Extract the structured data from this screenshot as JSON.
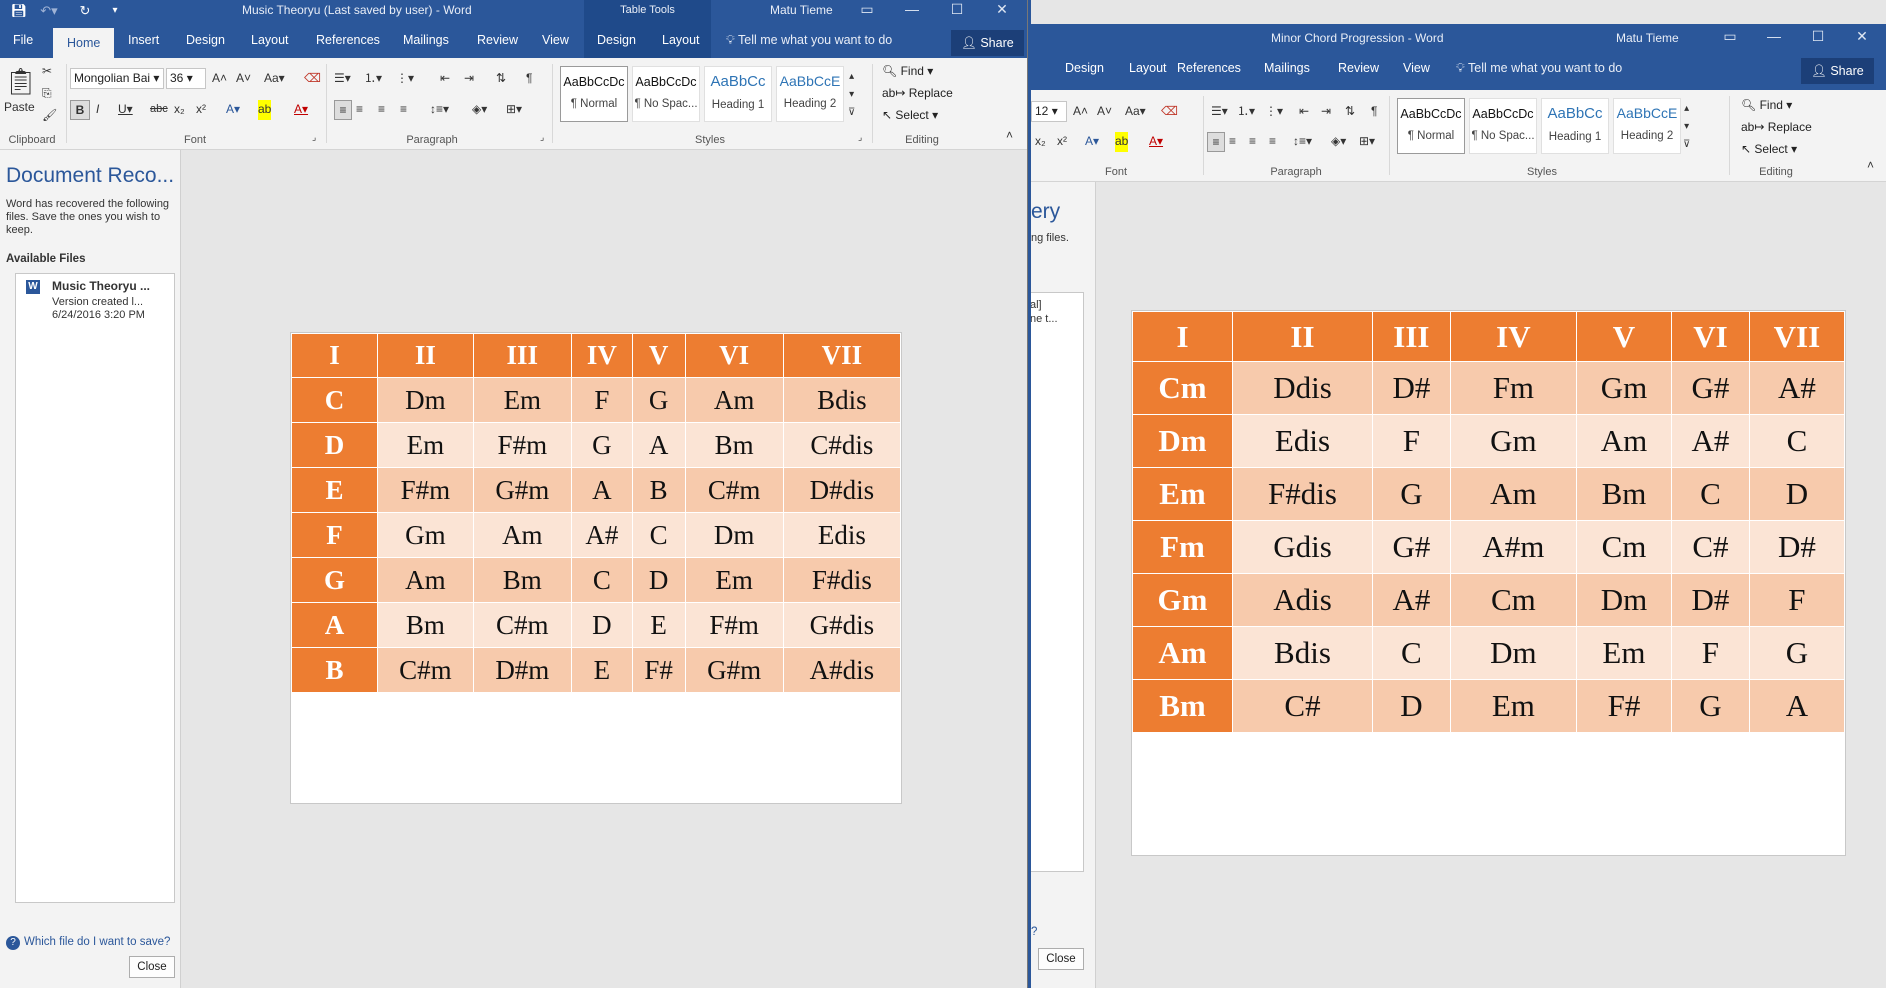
{
  "win1": {
    "title": "Music Theoryu (Last saved by user) - Word",
    "table_tools": "Table Tools",
    "user": "Matu Tieme",
    "tabs": [
      "File",
      "Home",
      "Insert",
      "Design",
      "Layout",
      "References",
      "Mailings",
      "Review",
      "View",
      "Design",
      "Layout"
    ],
    "tell_me": "Tell me what you want to do",
    "share": "Share",
    "font_name": "Mongolian Bai",
    "font_size": "36",
    "paste_label": "Paste",
    "groups": {
      "clipboard": "Clipboard",
      "font": "Font",
      "paragraph": "Paragraph",
      "styles": "Styles",
      "editing": "Editing"
    },
    "styles": [
      {
        "preview": "AaBbCcDc",
        "name": "¶ Normal"
      },
      {
        "preview": "AaBbCcDc",
        "name": "¶ No Spac..."
      },
      {
        "preview": "AaBbCc",
        "name": "Heading 1"
      },
      {
        "preview": "AaBbCcE",
        "name": "Heading 2"
      }
    ],
    "editing": {
      "find": "Find",
      "replace": "Replace",
      "select": "Select"
    },
    "recovery": {
      "title": "Document Reco...",
      "description": "Word has recovered the following files.  Save the ones you wish to keep.",
      "available": "Available Files",
      "file_name": "Music Theoryu ...",
      "file_version": "Version created l...",
      "file_date": "6/24/2016 3:20 PM",
      "help": "Which file do I want to save?",
      "close": "Close"
    },
    "table": {
      "header": [
        "I",
        "II",
        "III",
        "IV",
        "V",
        "VI",
        "VII"
      ],
      "rows": [
        [
          "C",
          "Dm",
          "Em",
          "F",
          "G",
          "Am",
          "Bdis"
        ],
        [
          "D",
          "Em",
          "F#m",
          "G",
          "A",
          "Bm",
          "C#dis"
        ],
        [
          "E",
          "F#m",
          "G#m",
          "A",
          "B",
          "C#m",
          "D#dis"
        ],
        [
          "F",
          "Gm",
          "Am",
          "A#",
          "C",
          "Dm",
          "Edis"
        ],
        [
          "G",
          "Am",
          "Bm",
          "C",
          "D",
          "Em",
          "F#dis"
        ],
        [
          "A",
          "Bm",
          "C#m",
          "D",
          "E",
          "F#m",
          "G#dis"
        ],
        [
          "B",
          "C#m",
          "D#m",
          "E",
          "F#",
          "G#m",
          "A#dis"
        ]
      ]
    }
  },
  "win2": {
    "title": "Minor Chord Progression - Word",
    "user": "Matu Tieme",
    "tabs": [
      "Design",
      "Layout",
      "References",
      "Mailings",
      "Review",
      "View"
    ],
    "tell_me": "Tell me what you want to do",
    "share": "Share",
    "font_size": "12",
    "groups": {
      "font": "Font",
      "paragraph": "Paragraph",
      "styles": "Styles",
      "editing": "Editing"
    },
    "styles": [
      {
        "preview": "AaBbCcDc",
        "name": "¶ Normal"
      },
      {
        "preview": "AaBbCcDc",
        "name": "¶ No Spac..."
      },
      {
        "preview": "AaBbCc",
        "name": "Heading 1"
      },
      {
        "preview": "AaBbCcE",
        "name": "Heading 2"
      }
    ],
    "editing": {
      "find": "Find",
      "replace": "Replace",
      "select": "Select"
    },
    "recovery_fragments": {
      "title": "ery",
      "text": "ng files.",
      "file1": "al]",
      "file2": "ne t...",
      "help": "?",
      "close": "Close"
    },
    "table": {
      "header": [
        "I",
        "II",
        "III",
        "IV",
        "V",
        "VI",
        "VII"
      ],
      "rows": [
        [
          "Cm",
          "Ddis",
          "D#",
          "Fm",
          "Gm",
          "G#",
          "A#"
        ],
        [
          "Dm",
          "Edis",
          "F",
          "Gm",
          "Am",
          "A#",
          "C"
        ],
        [
          "Em",
          "F#dis",
          "G",
          "Am",
          "Bm",
          "C",
          "D"
        ],
        [
          "Fm",
          "Gdis",
          "G#",
          "A#m",
          "Cm",
          "C#",
          "D#"
        ],
        [
          "Gm",
          "Adis",
          "A#",
          "Cm",
          "Dm",
          "D#",
          "F"
        ],
        [
          "Am",
          "Bdis",
          "C",
          "Dm",
          "Em",
          "F",
          "G"
        ],
        [
          "Bm",
          "C#",
          "D",
          "Em",
          "F#",
          "G",
          "A"
        ]
      ]
    }
  },
  "colors": {
    "word_blue": "#2b579a",
    "table_header": "#ed7d31",
    "row_dark": "#f7caac",
    "row_light": "#fbe4d5"
  }
}
